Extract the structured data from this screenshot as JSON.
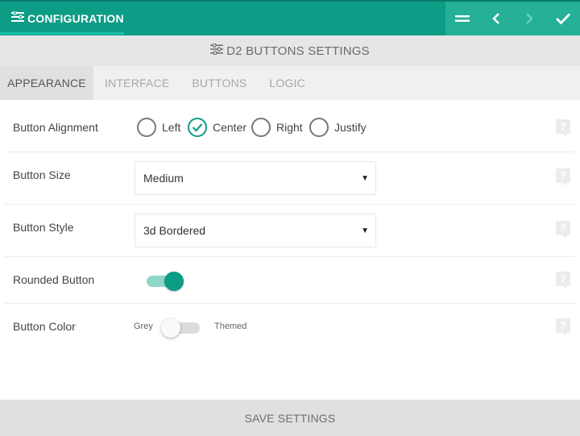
{
  "header": {
    "title": "CONFIGURATION",
    "title_icon": "list-settings-icon",
    "actions": [
      {
        "icon": "drag-handle-icon"
      },
      {
        "icon": "chevron-left-icon"
      },
      {
        "icon": "chevron-right-icon"
      },
      {
        "icon": "check-icon"
      }
    ]
  },
  "subheader": {
    "title": "D2 BUTTONS SETTINGS",
    "icon": "sliders-icon"
  },
  "tabs": [
    {
      "label": "APPEARANCE",
      "active": true
    },
    {
      "label": "INTERFACE",
      "active": false
    },
    {
      "label": "BUTTONS",
      "active": false
    },
    {
      "label": "LOGIC",
      "active": false
    }
  ],
  "rows": {
    "alignment": {
      "label": "Button Alignment",
      "options": [
        "Left",
        "Center",
        "Right",
        "Justify"
      ],
      "selected": "Center"
    },
    "size": {
      "label": "Button Size",
      "value": "Medium"
    },
    "style": {
      "label": "Button Style",
      "value": "3d Bordered"
    },
    "rounded": {
      "label": "Rounded Button",
      "on": true
    },
    "color": {
      "label": "Button Color",
      "off_label": "Grey",
      "on_label": "Themed",
      "on": false
    }
  },
  "help_glyph": "?",
  "caret_glyph": "▼",
  "footer": {
    "save_label": "SAVE SETTINGS"
  },
  "colors": {
    "accent": "#0d9c86",
    "header_right": "#25b097"
  }
}
